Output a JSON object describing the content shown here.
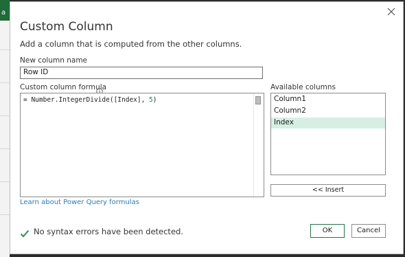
{
  "background": {
    "letter": "a"
  },
  "dialog": {
    "title": "Custom Column",
    "subtitle": "Add a column that is computed from the other columns.",
    "close_icon": "close-icon",
    "new_column_name_label": "New column name",
    "new_column_name_value": "Row ID",
    "formula_label": "Custom column formula",
    "formula": {
      "prefix": "= Number.IntegerDivide(",
      "arg1": "[Index], ",
      "arg2": "5",
      "suffix": ")"
    },
    "available_columns_label": "Available columns",
    "available_columns": [
      "Column1",
      "Column2",
      "Index"
    ],
    "selected_column": "Index",
    "insert_label": "<< Insert",
    "learn_link": "Learn about Power Query formulas",
    "status": "No syntax errors have been detected.",
    "ok_label": "OK",
    "cancel_label": "Cancel"
  },
  "colors": {
    "accent_green": "#217346",
    "check_green": "#2e8b57",
    "link_blue": "#2c7bb6",
    "selected_row": "#d6efe2"
  }
}
